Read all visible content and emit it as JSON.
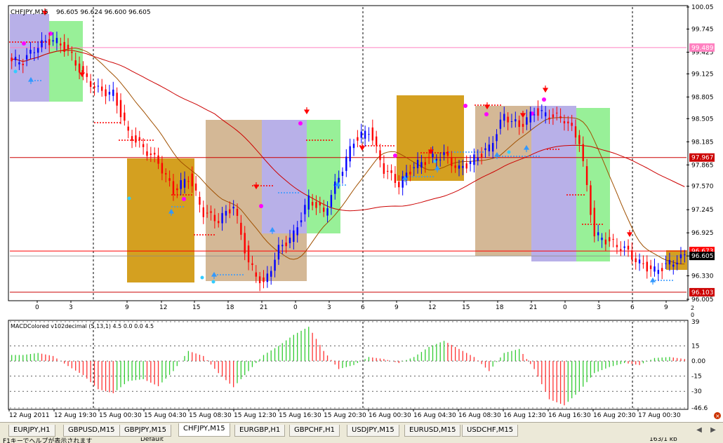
{
  "window": {
    "symbol_label": "CHFJPY,M15",
    "ohlc_label": "96.605 96.624 96.600 96.605"
  },
  "price_axis": {
    "ticks": [
      "100.05",
      "99.745",
      "99.425",
      "99.125",
      "98.805",
      "98.505",
      "98.185",
      "97.865",
      "97.570",
      "97.245",
      "96.925",
      "96.605",
      "96.330",
      "96.005"
    ],
    "ticks_values": [
      100.05,
      99.745,
      99.425,
      99.125,
      98.805,
      98.505,
      98.185,
      97.865,
      97.57,
      97.245,
      96.925,
      96.605,
      96.33,
      96.005
    ],
    "range": [
      96.005,
      100.05
    ]
  },
  "price_labels": [
    {
      "text": "99.489",
      "value": 99.489,
      "color": "#ff80c0"
    },
    {
      "text": "97.967",
      "value": 97.967,
      "color": "#cc0000"
    },
    {
      "text": "96.673",
      "value": 96.673,
      "color": "#ff0000"
    },
    {
      "text": "96.605",
      "value": 96.605,
      "color": "#000000"
    },
    {
      "text": "96.103",
      "value": 96.103,
      "color": "#cc0000"
    }
  ],
  "hour_axis": {
    "labels": [
      "0",
      "3",
      "9",
      "12",
      "15",
      "18",
      "21",
      "0",
      "3",
      "6",
      "9",
      "12",
      "15",
      "18",
      "21",
      "0",
      "3",
      "6",
      "9"
    ],
    "label_x": [
      53,
      101,
      181,
      230,
      277,
      325,
      373,
      421,
      469,
      517,
      565,
      613,
      661,
      709,
      757,
      805,
      853,
      901,
      949
    ]
  },
  "date_axis": {
    "labels": [
      "12 Aug 2011",
      "12 Aug 19:30",
      "15 Aug 00:30",
      "15 Aug 04:30",
      "15 Aug 08:30",
      "15 Aug 12:30",
      "15 Aug 16:30",
      "15 Aug 20:30",
      "16 Aug 00:30",
      "16 Aug 04:30",
      "16 Aug 08:30",
      "16 Aug 12:30",
      "16 Aug 16:30",
      "16 Aug 20:30",
      "17 Aug 00:30"
    ],
    "label_x": [
      13,
      77,
      141,
      205,
      269,
      333,
      397,
      461,
      525,
      589,
      653,
      717,
      781,
      845,
      909
    ]
  },
  "indicator": {
    "name": "MACDColored v102decimal (5,13,1) 4.5 0.0 0.0 4.5",
    "ticks": [
      "39",
      "15",
      "0.00",
      "-15",
      "-30",
      "-46.6"
    ],
    "ticks_values": [
      39,
      15,
      0,
      -15,
      -30,
      -46.6
    ],
    "range": [
      -46.6,
      39
    ]
  },
  "sub_axis_labels": [
    "2",
    "0"
  ],
  "tabs": [
    {
      "label": "EURJPY,H1",
      "active": false
    },
    {
      "label": "GBPUSD,M15",
      "active": false
    },
    {
      "label": "GBPJPY,M15",
      "active": false
    },
    {
      "label": "CHFJPY,M15",
      "active": true
    },
    {
      "label": "EURGBP,H1",
      "active": false
    },
    {
      "label": "GBPCHF,H1",
      "active": false
    },
    {
      "label": "USDJPY,M15",
      "active": false
    },
    {
      "label": "EURUSD,M15",
      "active": false
    },
    {
      "label": "USDCHF,M15",
      "active": false
    }
  ],
  "status": {
    "help_text": "F1キーでヘルプが表示されます",
    "profile": "Default",
    "connection": "163/1 kb"
  },
  "chart_data": [
    {
      "type": "candlestick",
      "title": "CHFJPY,M15",
      "ylim": [
        96.005,
        100.05
      ],
      "series": [
        {
          "name": "close",
          "values": [
            99.3,
            99.52,
            99.6,
            99.45,
            99.1,
            98.9,
            98.85,
            98.3,
            98.1,
            97.9,
            97.5,
            97.7,
            97.2,
            97.1,
            97.3,
            96.5,
            96.2,
            96.7,
            96.9,
            97.4,
            97.2,
            97.7,
            98.2,
            98.35,
            97.8,
            97.6,
            97.85,
            97.95,
            98.0,
            97.8,
            97.95,
            98.1,
            98.55,
            98.4,
            98.6,
            98.55,
            98.5,
            98.2,
            96.9,
            96.8,
            96.7,
            96.5,
            96.4,
            96.5,
            96.6
          ]
        }
      ]
    },
    {
      "type": "bar",
      "title": "MACDColored v102decimal (5,13,1) 4.5 0.0 0.0 4.5",
      "ylim": [
        -46.6,
        39
      ],
      "series": [
        {
          "name": "",
          "values": [
            6,
            8,
            5,
            -5,
            -14,
            -28,
            -32,
            -20,
            -18,
            -25,
            -10,
            10,
            5,
            -12,
            -26,
            -10,
            6,
            15,
            26,
            34,
            10,
            -8,
            -4,
            4,
            2,
            -2,
            4,
            14,
            20,
            12,
            4,
            -10,
            8,
            12,
            -8,
            -38,
            -44,
            -30,
            -12,
            -6,
            -2,
            -4,
            3,
            4,
            2
          ]
        }
      ]
    }
  ]
}
